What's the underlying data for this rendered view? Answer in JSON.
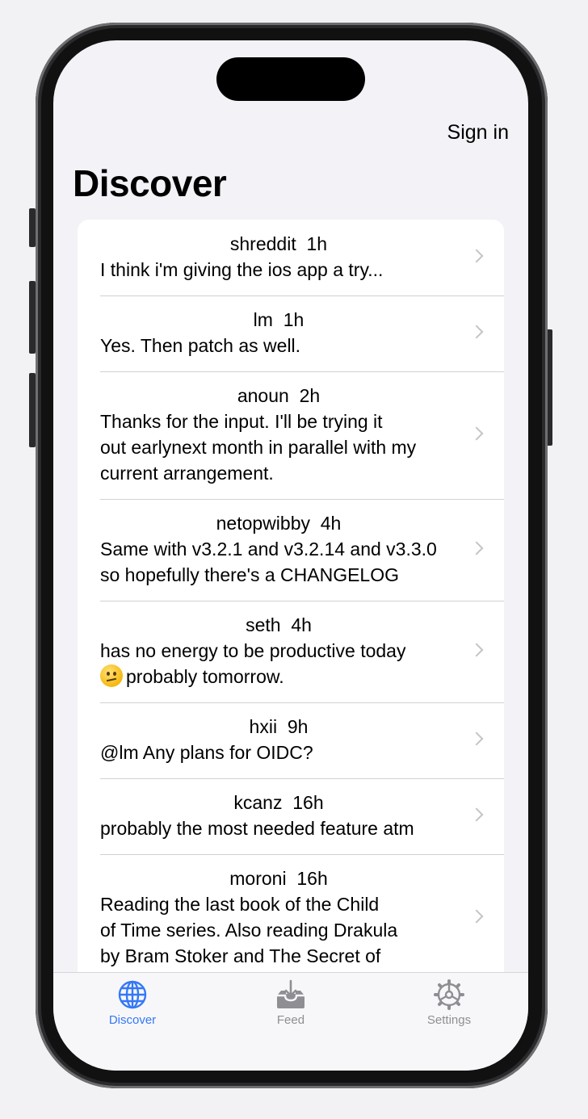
{
  "header": {
    "sign_in_label": "Sign in",
    "title": "Discover"
  },
  "posts": [
    {
      "user": "shreddit",
      "age": "1h",
      "lines": [
        "I think i'm giving the ios app a try..."
      ]
    },
    {
      "user": "lm",
      "age": "1h",
      "lines": [
        "Yes. Then patch as well."
      ]
    },
    {
      "user": "anoun",
      "age": "2h",
      "lines": [
        "Thanks for the input. I'll be trying it",
        "out earlynext month in parallel with my",
        "current arrangement."
      ]
    },
    {
      "user": "netopwibby",
      "age": "4h",
      "lines": [
        "Same with v3.2.1 and v3.2.14 and v3.3.0",
        "so hopefully there's a CHANGELOG"
      ]
    },
    {
      "user": "seth",
      "age": "4h",
      "lines": [
        "has no energy to be productive today",
        "probably tomorrow."
      ],
      "emoji": "confused-face"
    },
    {
      "user": "hxii",
      "age": "9h",
      "lines": [
        "@lm Any plans for OIDC?"
      ]
    },
    {
      "user": "kcanz",
      "age": "16h",
      "lines": [
        "probably the most needed feature atm"
      ]
    },
    {
      "user": "moroni",
      "age": "16h",
      "lines": [
        "Reading the last book of the Child",
        "of Time series. Also reading Drakula",
        "by Bram Stoker and The Secret of"
      ]
    }
  ],
  "tabbar": {
    "tabs": [
      {
        "label": "Discover",
        "icon": "globe-icon",
        "active": true
      },
      {
        "label": "Feed",
        "icon": "tray-download-icon",
        "active": false
      },
      {
        "label": "Settings",
        "icon": "gear-icon",
        "active": false
      }
    ],
    "active_color": "#3478f6",
    "inactive_color": "#8e8e93"
  }
}
